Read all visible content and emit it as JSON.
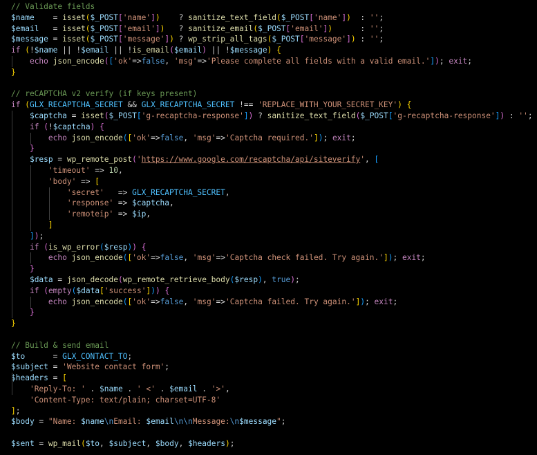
{
  "editor": {
    "lines": [
      [
        [
          "c",
          "// Validate fields"
        ]
      ],
      [
        [
          "v",
          "$name"
        ],
        [
          "p",
          "    = "
        ],
        [
          "f",
          "isset"
        ],
        [
          "y",
          "("
        ],
        [
          "v",
          "$_POST"
        ],
        [
          "m",
          "["
        ],
        [
          "s",
          "'name'"
        ],
        [
          "m",
          "]"
        ],
        [
          "y",
          ")"
        ],
        [
          "p",
          "    ? "
        ],
        [
          "f",
          "sanitize_text_field"
        ],
        [
          "y",
          "("
        ],
        [
          "v",
          "$_POST"
        ],
        [
          "m",
          "["
        ],
        [
          "s",
          "'name'"
        ],
        [
          "m",
          "]"
        ],
        [
          "y",
          ")"
        ],
        [
          "p",
          "  : "
        ],
        [
          "s",
          "''"
        ],
        [
          "p",
          ";"
        ]
      ],
      [
        [
          "v",
          "$email"
        ],
        [
          "p",
          "   = "
        ],
        [
          "f",
          "isset"
        ],
        [
          "y",
          "("
        ],
        [
          "v",
          "$_POST"
        ],
        [
          "m",
          "["
        ],
        [
          "s",
          "'email'"
        ],
        [
          "m",
          "]"
        ],
        [
          "y",
          ")"
        ],
        [
          "p",
          "   ? "
        ],
        [
          "f",
          "sanitize_email"
        ],
        [
          "y",
          "("
        ],
        [
          "v",
          "$_POST"
        ],
        [
          "m",
          "["
        ],
        [
          "s",
          "'email'"
        ],
        [
          "m",
          "]"
        ],
        [
          "y",
          ")"
        ],
        [
          "p",
          "      : "
        ],
        [
          "s",
          "''"
        ],
        [
          "p",
          ";"
        ]
      ],
      [
        [
          "v",
          "$message"
        ],
        [
          "p",
          " = "
        ],
        [
          "f",
          "isset"
        ],
        [
          "y",
          "("
        ],
        [
          "v",
          "$_POST"
        ],
        [
          "m",
          "["
        ],
        [
          "s",
          "'message'"
        ],
        [
          "m",
          "]"
        ],
        [
          "y",
          ")"
        ],
        [
          "p",
          " ? "
        ],
        [
          "f",
          "wp_strip_all_tags"
        ],
        [
          "y",
          "("
        ],
        [
          "v",
          "$_POST"
        ],
        [
          "m",
          "["
        ],
        [
          "s",
          "'message'"
        ],
        [
          "m",
          "]"
        ],
        [
          "y",
          ")"
        ],
        [
          "p",
          " : "
        ],
        [
          "s",
          "''"
        ],
        [
          "p",
          ";"
        ]
      ],
      [
        [
          "k",
          "if"
        ],
        [
          "p",
          " "
        ],
        [
          "y",
          "("
        ],
        [
          "p",
          "!"
        ],
        [
          "v",
          "$name"
        ],
        [
          "p",
          " || !"
        ],
        [
          "v",
          "$email"
        ],
        [
          "p",
          " || !"
        ],
        [
          "f",
          "is_email"
        ],
        [
          "m",
          "("
        ],
        [
          "v",
          "$email"
        ],
        [
          "m",
          ")"
        ],
        [
          "p",
          " || !"
        ],
        [
          "v",
          "$message"
        ],
        [
          "y",
          ")"
        ],
        [
          "p",
          " "
        ],
        [
          "y",
          "{"
        ]
      ],
      [
        [
          "p",
          "    "
        ],
        [
          "k",
          "echo"
        ],
        [
          "p",
          " "
        ],
        [
          "f",
          "json_encode"
        ],
        [
          "m",
          "("
        ],
        [
          "u",
          "["
        ],
        [
          "s",
          "'ok'"
        ],
        [
          "p",
          "=>"
        ],
        [
          "b",
          "false"
        ],
        [
          "p",
          ", "
        ],
        [
          "s",
          "'msg'"
        ],
        [
          "p",
          "=>"
        ],
        [
          "s",
          "'Please complete all fields with a valid email.'"
        ],
        [
          "u",
          "]"
        ],
        [
          "m",
          ")"
        ],
        [
          "p",
          "; "
        ],
        [
          "k",
          "exit"
        ],
        [
          "p",
          ";"
        ]
      ],
      [
        [
          "y",
          "}"
        ]
      ],
      [],
      [
        [
          "c",
          "// reCAPTCHA v2 verify (if keys present)"
        ]
      ],
      [
        [
          "k",
          "if"
        ],
        [
          "p",
          " "
        ],
        [
          "y",
          "("
        ],
        [
          "cn",
          "GLX_RECAPTCHA_SECRET"
        ],
        [
          "p",
          " && "
        ],
        [
          "cn",
          "GLX_RECAPTCHA_SECRET"
        ],
        [
          "p",
          " !== "
        ],
        [
          "s",
          "'REPLACE_WITH_YOUR_SECRET_KEY'"
        ],
        [
          "y",
          ")"
        ],
        [
          "p",
          " "
        ],
        [
          "y",
          "{"
        ]
      ],
      [
        [
          "p",
          "    "
        ],
        [
          "v",
          "$captcha"
        ],
        [
          "p",
          " = "
        ],
        [
          "f",
          "isset"
        ],
        [
          "m",
          "("
        ],
        [
          "v",
          "$_POST"
        ],
        [
          "u",
          "["
        ],
        [
          "s",
          "'g-recaptcha-response'"
        ],
        [
          "u",
          "]"
        ],
        [
          "m",
          ")"
        ],
        [
          "p",
          " ? "
        ],
        [
          "f",
          "sanitize_text_field"
        ],
        [
          "m",
          "("
        ],
        [
          "v",
          "$_POST"
        ],
        [
          "u",
          "["
        ],
        [
          "s",
          "'g-recaptcha-response'"
        ],
        [
          "u",
          "]"
        ],
        [
          "m",
          ")"
        ],
        [
          "p",
          " : "
        ],
        [
          "s",
          "''"
        ],
        [
          "p",
          ";"
        ]
      ],
      [
        [
          "p",
          "    "
        ],
        [
          "k",
          "if"
        ],
        [
          "p",
          " "
        ],
        [
          "m",
          "("
        ],
        [
          "p",
          "!"
        ],
        [
          "v",
          "$captcha"
        ],
        [
          "m",
          ")"
        ],
        [
          "p",
          " "
        ],
        [
          "m",
          "{"
        ]
      ],
      [
        [
          "p",
          "        "
        ],
        [
          "k",
          "echo"
        ],
        [
          "p",
          " "
        ],
        [
          "f",
          "json_encode"
        ],
        [
          "u",
          "("
        ],
        [
          "y",
          "["
        ],
        [
          "s",
          "'ok'"
        ],
        [
          "p",
          "=>"
        ],
        [
          "b",
          "false"
        ],
        [
          "p",
          ", "
        ],
        [
          "s",
          "'msg'"
        ],
        [
          "p",
          "=>"
        ],
        [
          "s",
          "'Captcha required.'"
        ],
        [
          "y",
          "]"
        ],
        [
          "u",
          ")"
        ],
        [
          "p",
          "; "
        ],
        [
          "k",
          "exit"
        ],
        [
          "p",
          ";"
        ]
      ],
      [
        [
          "p",
          "    "
        ],
        [
          "m",
          "}"
        ]
      ],
      [
        [
          "p",
          "    "
        ],
        [
          "v",
          "$resp"
        ],
        [
          "p",
          " = "
        ],
        [
          "f",
          "wp_remote_post"
        ],
        [
          "m",
          "("
        ],
        [
          "s",
          "'"
        ],
        [
          "url",
          "https://www.google.com/recaptcha/api/siteverify"
        ],
        [
          "s",
          "'"
        ],
        [
          "p",
          ", "
        ],
        [
          "u",
          "["
        ]
      ],
      [
        [
          "p",
          "        "
        ],
        [
          "s",
          "'timeout'"
        ],
        [
          "p",
          " => "
        ],
        [
          "n",
          "10"
        ],
        [
          "p",
          ","
        ]
      ],
      [
        [
          "p",
          "        "
        ],
        [
          "s",
          "'body'"
        ],
        [
          "p",
          " => "
        ],
        [
          "y",
          "["
        ]
      ],
      [
        [
          "p",
          "            "
        ],
        [
          "s",
          "'secret'"
        ],
        [
          "p",
          "   => "
        ],
        [
          "cn",
          "GLX_RECAPTCHA_SECRET"
        ],
        [
          "p",
          ","
        ]
      ],
      [
        [
          "p",
          "            "
        ],
        [
          "s",
          "'response'"
        ],
        [
          "p",
          " => "
        ],
        [
          "v",
          "$captcha"
        ],
        [
          "p",
          ","
        ]
      ],
      [
        [
          "p",
          "            "
        ],
        [
          "s",
          "'remoteip'"
        ],
        [
          "p",
          " => "
        ],
        [
          "v",
          "$ip"
        ],
        [
          "p",
          ","
        ]
      ],
      [
        [
          "p",
          "        "
        ],
        [
          "y",
          "]"
        ]
      ],
      [
        [
          "p",
          "    "
        ],
        [
          "u",
          "]"
        ],
        [
          "m",
          ")"
        ],
        [
          "p",
          ";"
        ]
      ],
      [
        [
          "p",
          "    "
        ],
        [
          "k",
          "if"
        ],
        [
          "p",
          " "
        ],
        [
          "m",
          "("
        ],
        [
          "f",
          "is_wp_error"
        ],
        [
          "u",
          "("
        ],
        [
          "v",
          "$resp"
        ],
        [
          "u",
          ")"
        ],
        [
          "m",
          ")"
        ],
        [
          "p",
          " "
        ],
        [
          "m",
          "{"
        ]
      ],
      [
        [
          "p",
          "        "
        ],
        [
          "k",
          "echo"
        ],
        [
          "p",
          " "
        ],
        [
          "f",
          "json_encode"
        ],
        [
          "u",
          "("
        ],
        [
          "y",
          "["
        ],
        [
          "s",
          "'ok'"
        ],
        [
          "p",
          "=>"
        ],
        [
          "b",
          "false"
        ],
        [
          "p",
          ", "
        ],
        [
          "s",
          "'msg'"
        ],
        [
          "p",
          "=>"
        ],
        [
          "s",
          "'Captcha check failed. Try again.'"
        ],
        [
          "y",
          "]"
        ],
        [
          "u",
          ")"
        ],
        [
          "p",
          "; "
        ],
        [
          "k",
          "exit"
        ],
        [
          "p",
          ";"
        ]
      ],
      [
        [
          "p",
          "    "
        ],
        [
          "m",
          "}"
        ]
      ],
      [
        [
          "p",
          "    "
        ],
        [
          "v",
          "$data"
        ],
        [
          "p",
          " = "
        ],
        [
          "f",
          "json_decode"
        ],
        [
          "m",
          "("
        ],
        [
          "f",
          "wp_remote_retrieve_body"
        ],
        [
          "u",
          "("
        ],
        [
          "v",
          "$resp"
        ],
        [
          "u",
          ")"
        ],
        [
          "p",
          ", "
        ],
        [
          "b",
          "true"
        ],
        [
          "m",
          ")"
        ],
        [
          "p",
          ";"
        ]
      ],
      [
        [
          "p",
          "    "
        ],
        [
          "k",
          "if"
        ],
        [
          "p",
          " "
        ],
        [
          "m",
          "("
        ],
        [
          "k",
          "empty"
        ],
        [
          "u",
          "("
        ],
        [
          "v",
          "$data"
        ],
        [
          "y",
          "["
        ],
        [
          "s",
          "'success'"
        ],
        [
          "y",
          "]"
        ],
        [
          "u",
          ")"
        ],
        [
          "m",
          ")"
        ],
        [
          "p",
          " "
        ],
        [
          "m",
          "{"
        ]
      ],
      [
        [
          "p",
          "        "
        ],
        [
          "k",
          "echo"
        ],
        [
          "p",
          " "
        ],
        [
          "f",
          "json_encode"
        ],
        [
          "u",
          "("
        ],
        [
          "y",
          "["
        ],
        [
          "s",
          "'ok'"
        ],
        [
          "p",
          "=>"
        ],
        [
          "b",
          "false"
        ],
        [
          "p",
          ", "
        ],
        [
          "s",
          "'msg'"
        ],
        [
          "p",
          "=>"
        ],
        [
          "s",
          "'Captcha failed. Try again.'"
        ],
        [
          "y",
          "]"
        ],
        [
          "u",
          ")"
        ],
        [
          "p",
          "; "
        ],
        [
          "k",
          "exit"
        ],
        [
          "p",
          ";"
        ]
      ],
      [
        [
          "p",
          "    "
        ],
        [
          "m",
          "}"
        ]
      ],
      [
        [
          "y",
          "}"
        ]
      ],
      [],
      [
        [
          "c",
          "// Build & send email"
        ]
      ],
      [
        [
          "v",
          "$to"
        ],
        [
          "p",
          "      = "
        ],
        [
          "cn",
          "GLX_CONTACT_TO"
        ],
        [
          "p",
          ";"
        ]
      ],
      [
        [
          "v",
          "$subject"
        ],
        [
          "p",
          " = "
        ],
        [
          "s",
          "'Website contact form'"
        ],
        [
          "p",
          ";"
        ]
      ],
      [
        [
          "v",
          "$headers"
        ],
        [
          "p",
          " = "
        ],
        [
          "y",
          "["
        ]
      ],
      [
        [
          "p",
          "    "
        ],
        [
          "s",
          "'Reply-To: '"
        ],
        [
          "p",
          " . "
        ],
        [
          "v",
          "$name"
        ],
        [
          "p",
          " . "
        ],
        [
          "s",
          "' <'"
        ],
        [
          "p",
          " . "
        ],
        [
          "v",
          "$email"
        ],
        [
          "p",
          " . "
        ],
        [
          "s",
          "'>'"
        ],
        [
          "p",
          ","
        ]
      ],
      [
        [
          "p",
          "    "
        ],
        [
          "s",
          "'Content-Type: text/plain; charset=UTF-8'"
        ]
      ],
      [
        [
          "y",
          "]"
        ],
        [
          "p",
          ";"
        ]
      ],
      [
        [
          "v",
          "$body"
        ],
        [
          "p",
          " = "
        ],
        [
          "s",
          "\"Name: "
        ],
        [
          "v",
          "$name"
        ],
        [
          "b",
          "\\n"
        ],
        [
          "s",
          "Email: "
        ],
        [
          "v",
          "$email"
        ],
        [
          "b",
          "\\n\\n"
        ],
        [
          "s",
          "Message:"
        ],
        [
          "b",
          "\\n"
        ],
        [
          "v",
          "$message"
        ],
        [
          "s",
          "\""
        ],
        [
          "p",
          ";"
        ]
      ],
      [],
      [
        [
          "v",
          "$sent"
        ],
        [
          "p",
          " = "
        ],
        [
          "f",
          "wp_mail"
        ],
        [
          "y",
          "("
        ],
        [
          "v",
          "$to"
        ],
        [
          "p",
          ", "
        ],
        [
          "v",
          "$subject"
        ],
        [
          "p",
          ", "
        ],
        [
          "v",
          "$body"
        ],
        [
          "p",
          ", "
        ],
        [
          "v",
          "$headers"
        ],
        [
          "y",
          ")"
        ],
        [
          "p",
          ";"
        ]
      ]
    ]
  }
}
